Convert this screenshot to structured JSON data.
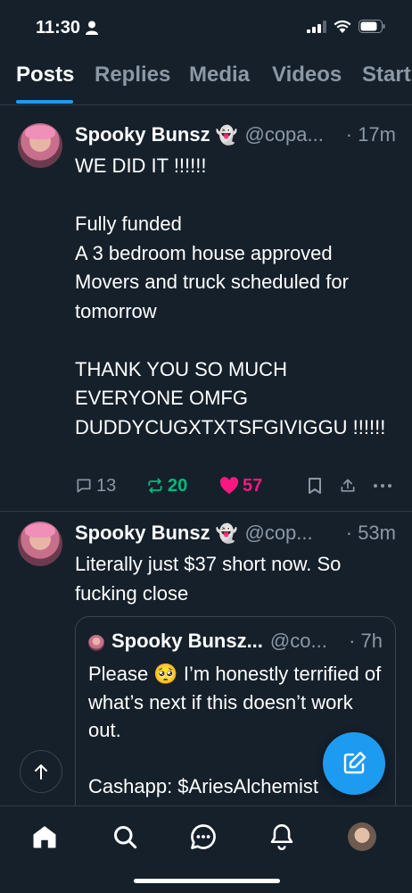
{
  "status_bar": {
    "time": "11:30"
  },
  "tabs": [
    {
      "label": "Posts",
      "active": true
    },
    {
      "label": "Replies",
      "active": false
    },
    {
      "label": "Media",
      "active": false
    },
    {
      "label": "Videos",
      "active": false
    },
    {
      "label": "Start",
      "active": false
    }
  ],
  "posts": [
    {
      "name": "Spooky Bunsz",
      "emoji": "👻",
      "handle": "@copa...",
      "time": "· 17m",
      "text": "WE DID IT !!!!!!\n\nFully funded\nA 3 bedroom house approved\nMovers and truck scheduled for tomorrow\n\nTHANK YOU SO MUCH EVERYONE OMFG DUDDYCUGXTXTSFGIVIGGU !!!!!!",
      "replies": "13",
      "retweets": "20",
      "likes": "57"
    },
    {
      "name": "Spooky Bunsz",
      "emoji": "👻",
      "handle": "@cop...",
      "time": "· 53m",
      "text": "Literally just $37 short now. So fucking close",
      "quote": {
        "name": "Spooky Bunsz...",
        "handle": "@co...",
        "time": "· 7h",
        "text": "Please 🥺 I’m honestly terrified of what’s next if this doesn’t work out.\n\nCashapp: $AriesAlchemist"
      }
    }
  ],
  "colors": {
    "background": "#15202b",
    "accent": "#1d9bf0",
    "retweet": "#00ba7c",
    "like": "#f91880",
    "muted": "#8b98a5"
  },
  "nav": {
    "icons": [
      "home-icon",
      "search-icon",
      "messages-icon",
      "notifications-icon",
      "profile-avatar"
    ]
  }
}
